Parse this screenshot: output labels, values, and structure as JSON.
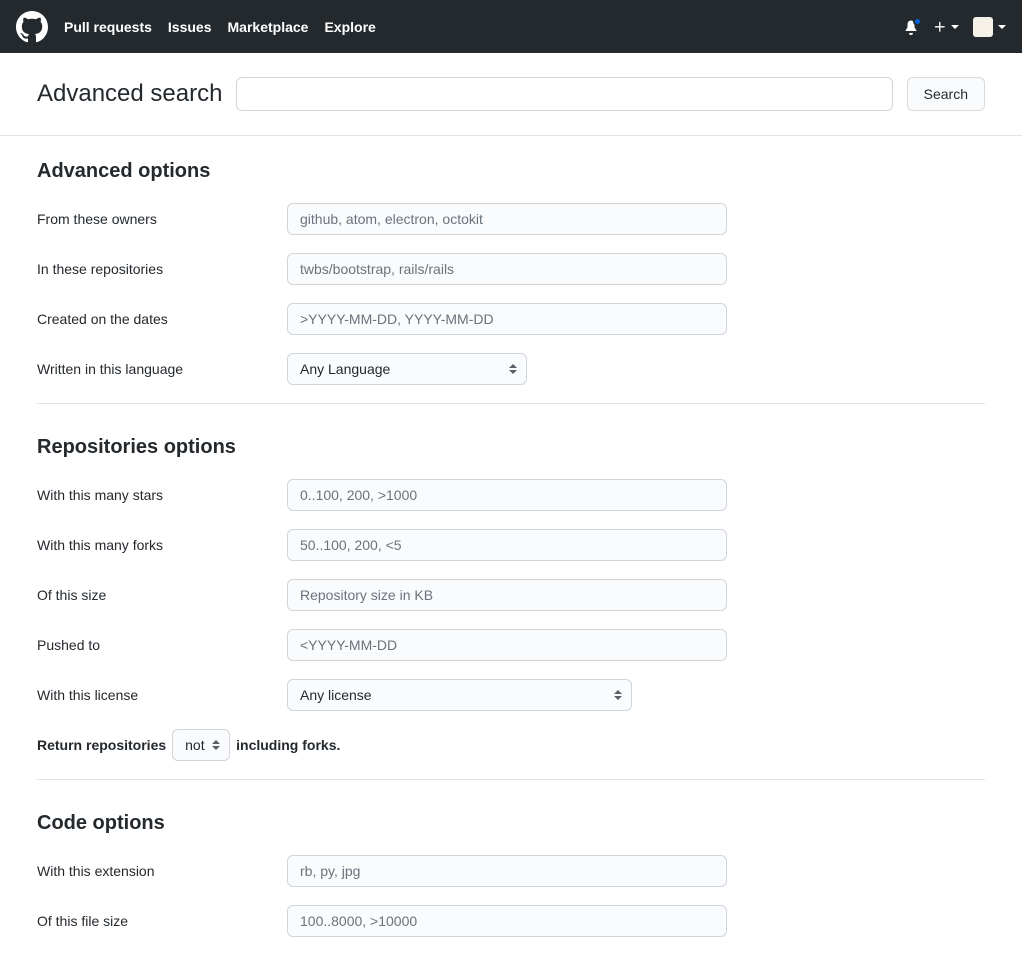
{
  "header": {
    "nav": {
      "pull_requests": "Pull requests",
      "issues": "Issues",
      "marketplace": "Marketplace",
      "explore": "Explore"
    }
  },
  "search": {
    "title": "Advanced search",
    "button": "Search",
    "value": ""
  },
  "sections": {
    "advanced": {
      "heading": "Advanced options",
      "owners": {
        "label": "From these owners",
        "placeholder": "github, atom, electron, octokit"
      },
      "repos": {
        "label": "In these repositories",
        "placeholder": "twbs/bootstrap, rails/rails"
      },
      "created": {
        "label": "Created on the dates",
        "placeholder": ">YYYY-MM-DD, YYYY-MM-DD"
      },
      "language": {
        "label": "Written in this language",
        "selected": "Any Language"
      }
    },
    "repositories": {
      "heading": "Repositories options",
      "stars": {
        "label": "With this many stars",
        "placeholder": "0..100, 200, >1000"
      },
      "forks": {
        "label": "With this many forks",
        "placeholder": "50..100, 200, <5"
      },
      "size": {
        "label": "Of this size",
        "placeholder": "Repository size in KB"
      },
      "pushed": {
        "label": "Pushed to",
        "placeholder": "<YYYY-MM-DD"
      },
      "license": {
        "label": "With this license",
        "selected": "Any license"
      },
      "forks_sentence_pre": "Return repositories",
      "forks_sentence_post": "including forks.",
      "forks_option": "not"
    },
    "code": {
      "heading": "Code options",
      "extension": {
        "label": "With this extension",
        "placeholder": "rb, py, jpg"
      },
      "filesize": {
        "label": "Of this file size",
        "placeholder": "100..8000, >10000"
      }
    }
  }
}
